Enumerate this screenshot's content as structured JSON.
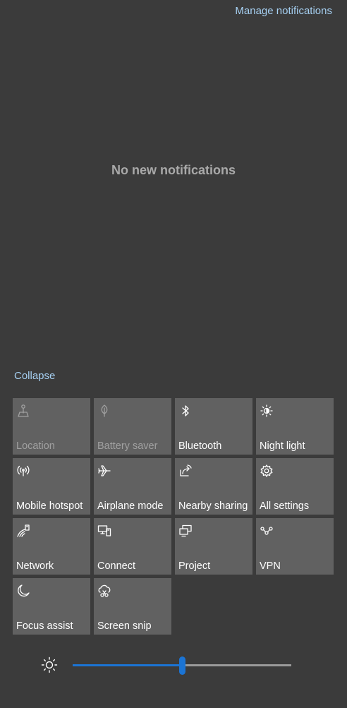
{
  "header": {
    "manage_label": "Manage notifications"
  },
  "notifications": {
    "empty_message": "No new notifications"
  },
  "quick_actions": {
    "collapse_label": "Collapse",
    "tiles": [
      {
        "label": "Location",
        "icon": "location-icon",
        "enabled": false
      },
      {
        "label": "Battery saver",
        "icon": "leaf-icon",
        "enabled": false
      },
      {
        "label": "Bluetooth",
        "icon": "bluetooth-icon",
        "enabled": true
      },
      {
        "label": "Night light",
        "icon": "sun-moon-icon",
        "enabled": true
      },
      {
        "label": "Mobile hotspot",
        "icon": "hotspot-icon",
        "enabled": true
      },
      {
        "label": "Airplane mode",
        "icon": "airplane-icon",
        "enabled": true
      },
      {
        "label": "Nearby sharing",
        "icon": "share-icon",
        "enabled": true
      },
      {
        "label": "All settings",
        "icon": "gear-icon",
        "enabled": true
      },
      {
        "label": "Network",
        "icon": "network-icon",
        "enabled": true
      },
      {
        "label": "Connect",
        "icon": "connect-icon",
        "enabled": true
      },
      {
        "label": "Project",
        "icon": "project-icon",
        "enabled": true
      },
      {
        "label": "VPN",
        "icon": "vpn-icon",
        "enabled": true
      },
      {
        "label": "Focus assist",
        "icon": "moon-icon",
        "enabled": true
      },
      {
        "label": "Screen snip",
        "icon": "scissors-icon",
        "enabled": true
      }
    ]
  },
  "brightness": {
    "icon": "brightness-icon",
    "level_percent": 50,
    "accent_color": "#1b74d4"
  },
  "colors": {
    "background": "#3b3b3b",
    "tile": "#616161",
    "link": "#a6d0f2"
  }
}
